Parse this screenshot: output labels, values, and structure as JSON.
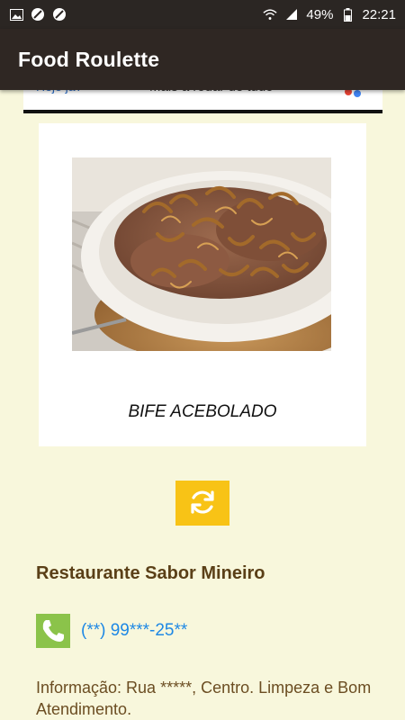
{
  "status_bar": {
    "battery": "49%",
    "time": "22:21"
  },
  "app_bar": {
    "title": "Food Roulette"
  },
  "ad": {
    "left_text": "Hoje já?",
    "center_text": "Mais a rodar de tudo"
  },
  "dish": {
    "name": "BIFE ACEBOLADO",
    "image_icon": "steak-with-onions-photo"
  },
  "refresh": {
    "icon": "refresh-icon",
    "color": "#f8c316"
  },
  "restaurant": {
    "name": "Restaurante Sabor Mineiro",
    "phone": "(**) 99***-25**",
    "info": "Informação: Rua  *****, Centro. Limpeza e Bom Atendimento."
  },
  "colors": {
    "background": "#f8f7dc",
    "app_bar": "#2f2723",
    "phone_icon_bg": "#8bc34a",
    "phone_text": "#1e88e5",
    "restaurant_text": "#5a3f17"
  }
}
